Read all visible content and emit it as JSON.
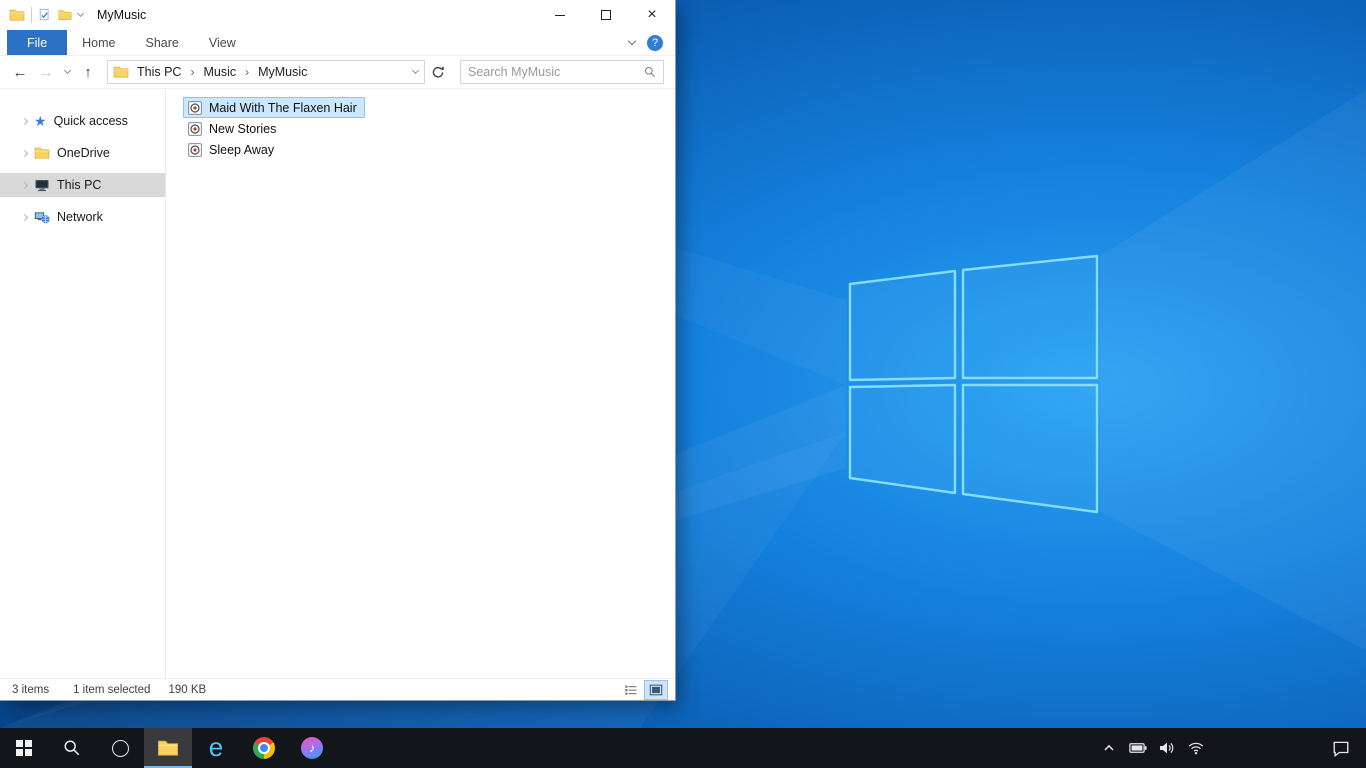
{
  "colors": {
    "file_tab_blue": "#2b71c4",
    "selection_fill": "#cce8ff",
    "selection_border": "#8fc4ef",
    "nav_selected_gray": "#d9d9d9",
    "taskbar_bg": "#12151a",
    "desktop_blue": "#1480dd"
  },
  "window": {
    "title": "MyMusic"
  },
  "ribbon": {
    "tabs": [
      {
        "label": "File"
      },
      {
        "label": "Home"
      },
      {
        "label": "Share"
      },
      {
        "label": "View"
      }
    ],
    "help_glyph": "?"
  },
  "navbar": {
    "back_glyph": "←",
    "forward_glyph": "→",
    "up_glyph": "↑",
    "separator_glyph": "›",
    "breadcrumb": [
      {
        "label": "This PC"
      },
      {
        "label": "Music"
      },
      {
        "label": "MyMusic"
      }
    ],
    "search_placeholder": "Search MyMusic"
  },
  "sidebar": {
    "star_glyph": "★",
    "items": [
      {
        "label": "Quick access",
        "icon": "star-icon",
        "selected": false
      },
      {
        "label": "OneDrive",
        "icon": "folder-icon",
        "selected": false
      },
      {
        "label": "This PC",
        "icon": "computer-icon",
        "selected": true
      },
      {
        "label": "Network",
        "icon": "network-icon",
        "selected": false
      }
    ]
  },
  "files": [
    {
      "name": "Maid With The Flaxen Hair",
      "icon": "audio-file-icon",
      "selected": true
    },
    {
      "name": "New Stories",
      "icon": "audio-file-icon",
      "selected": false
    },
    {
      "name": "Sleep Away",
      "icon": "audio-file-icon",
      "selected": false
    }
  ],
  "statusbar": {
    "items_count": "3 items",
    "selection": "1 item selected",
    "selection_size": "190 KB"
  },
  "taskbar": {
    "icons": [
      "start",
      "search",
      "cortana",
      "file-explorer",
      "internet-explorer",
      "chrome",
      "itunes"
    ],
    "active_icon": "file-explorer",
    "ie_glyph": "e",
    "itunes_glyph": "♪",
    "tray_icons": [
      "chevron-up",
      "battery",
      "speaker",
      "wifi",
      "action-center"
    ]
  }
}
